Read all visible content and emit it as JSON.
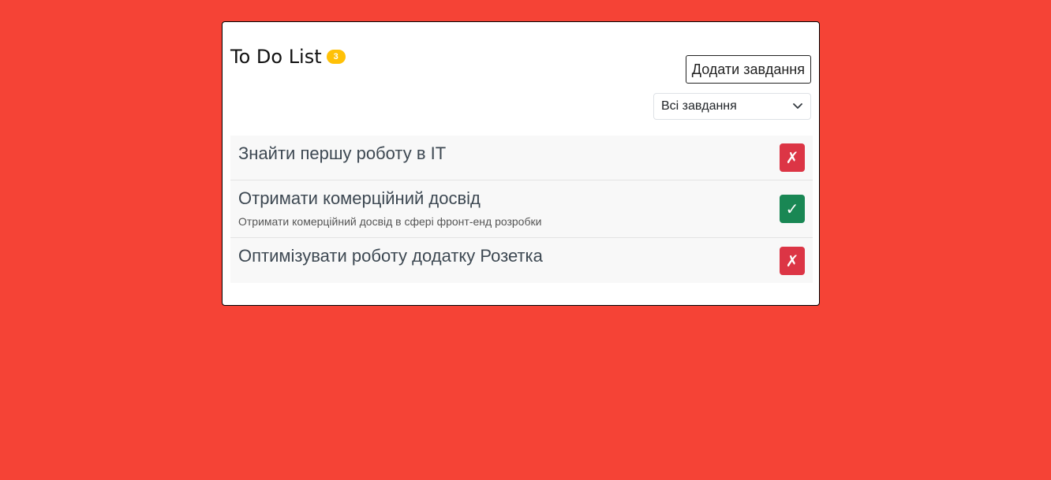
{
  "app": {
    "title": "To Do List",
    "count_badge": "3"
  },
  "toolbar": {
    "add_label": "Додати завдання"
  },
  "filter": {
    "selected": "Всі завдання"
  },
  "tasks": [
    {
      "title": "Знайти першу роботу в IT",
      "description": "",
      "status": "undone",
      "status_glyph": "✗"
    },
    {
      "title": "Отримати комерційний досвід",
      "description": "Отримати комерційний досвід в сфері фронт-енд розробки",
      "status": "done",
      "status_glyph": "✓"
    },
    {
      "title": "Оптимізувати роботу додатку Розетка",
      "description": "",
      "status": "undone",
      "status_glyph": "✗"
    }
  ],
  "colors": {
    "background": "#f54336",
    "badge": "#ffc107",
    "undone": "#dc3545",
    "done": "#198754"
  },
  "icons": {
    "filter_dropdown": "chevron-down-icon"
  }
}
